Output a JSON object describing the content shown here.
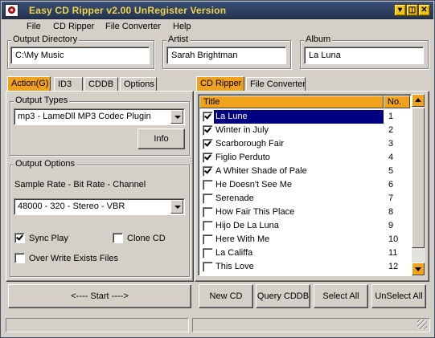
{
  "window": {
    "title": "Easy CD Ripper v2.00 UnRegister Version",
    "minimize_glyph": "▾",
    "restore_glyph": "◫",
    "close_glyph": "✕"
  },
  "menu": [
    {
      "label": "File",
      "mnemonic": "F"
    },
    {
      "label": "CD Ripper",
      "mnemonic": "C"
    },
    {
      "label": "File Converter",
      "mnemonic": ""
    },
    {
      "label": "Help",
      "mnemonic": "H"
    }
  ],
  "output_directory": {
    "label": "Output Directory",
    "value": "C:\\My Music"
  },
  "artist": {
    "label": "Artist",
    "value": "Sarah Brightman"
  },
  "album": {
    "label": "Album",
    "value": "La Luna"
  },
  "left_tabs": [
    {
      "label": "Action(G)",
      "active": true
    },
    {
      "label": "ID3",
      "active": false
    },
    {
      "label": "CDDB",
      "active": false
    },
    {
      "label": "Options",
      "active": false
    }
  ],
  "output_types": {
    "label": "Output Types",
    "selected": "mp3 - LameDll MP3 Codec Plugin",
    "info_button": "Info"
  },
  "output_options": {
    "label": "Output Options",
    "caption": "Sample Rate - Bit Rate - Channel",
    "selected": "48000 - 320 - Stereo - VBR",
    "sync_play": {
      "label": "Sync Play",
      "checked": true
    },
    "clone_cd": {
      "label": "Clone CD",
      "checked": false
    },
    "overwrite": {
      "label": "Over Write Exists Files",
      "checked": false
    }
  },
  "start_button": "<---- Start ---->",
  "right_tabs": [
    {
      "label": "CD Ripper",
      "active": true
    },
    {
      "label": "File Converter",
      "active": false
    }
  ],
  "track_list": {
    "columns": {
      "title": "Title",
      "no": "No."
    },
    "tracks": [
      {
        "title": "La Lune",
        "no": "1",
        "checked": true,
        "selected": true
      },
      {
        "title": "Winter in July",
        "no": "2",
        "checked": true,
        "selected": false
      },
      {
        "title": "Scarborough Fair",
        "no": "3",
        "checked": true,
        "selected": false
      },
      {
        "title": "Figlio Perduto",
        "no": "4",
        "checked": true,
        "selected": false
      },
      {
        "title": "A Whiter Shade of Pale",
        "no": "5",
        "checked": true,
        "selected": false
      },
      {
        "title": "He Doesn't See Me",
        "no": "6",
        "checked": false,
        "selected": false
      },
      {
        "title": "Serenade",
        "no": "7",
        "checked": false,
        "selected": false
      },
      {
        "title": "How Fair This Place",
        "no": "8",
        "checked": false,
        "selected": false
      },
      {
        "title": "Hijo De La Luna",
        "no": "9",
        "checked": false,
        "selected": false
      },
      {
        "title": "Here With Me",
        "no": "10",
        "checked": false,
        "selected": false
      },
      {
        "title": "La Califfa",
        "no": "11",
        "checked": false,
        "selected": false
      },
      {
        "title": "This Love",
        "no": "12",
        "checked": false,
        "selected": false
      }
    ]
  },
  "bottom_buttons": {
    "new_cd": "New CD",
    "query_cddb": "Query CDDB",
    "select_all": "Select All",
    "unselect_all": "UnSelect All"
  },
  "colors": {
    "title_text": "#f0d44a",
    "accent_orange": "#f0a21c",
    "selection": "#000080"
  }
}
